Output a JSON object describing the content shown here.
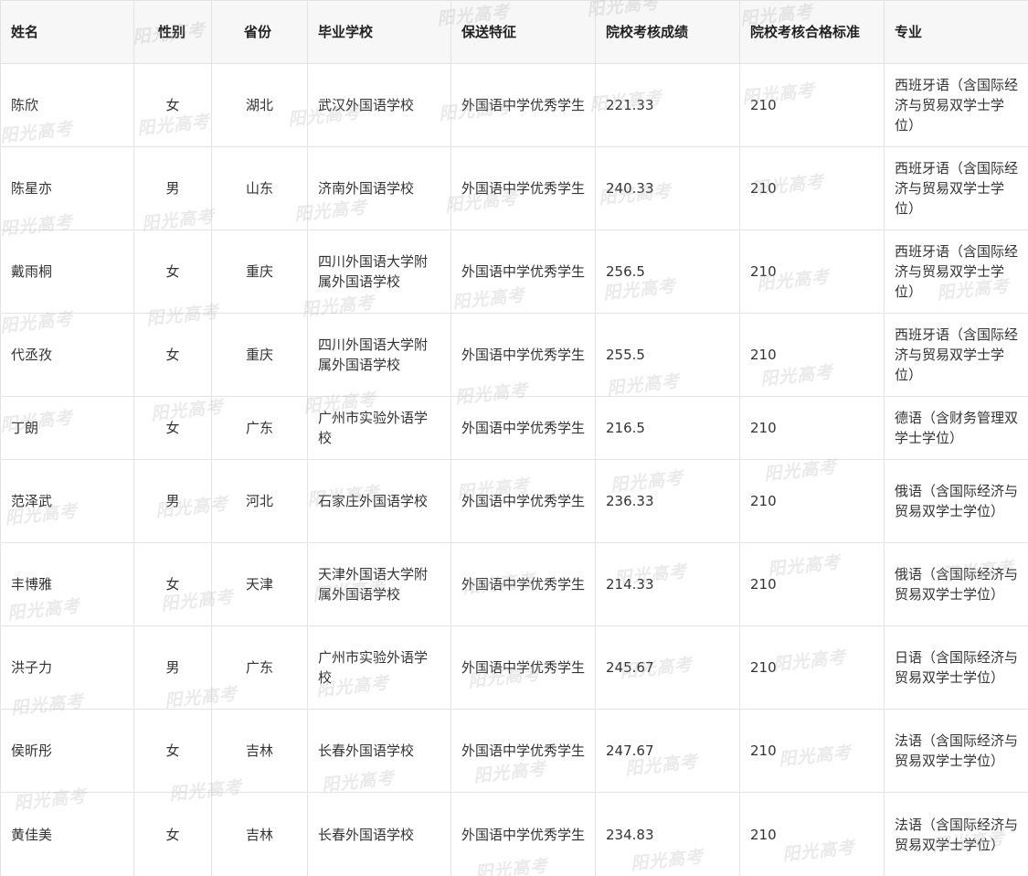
{
  "headers": {
    "name": "姓名",
    "gender": "性别",
    "province": "省份",
    "school": "毕业学校",
    "feature": "保送特征",
    "score": "院校考核成绩",
    "standard": "院校考核合格标准",
    "major": "专业"
  },
  "rows": [
    {
      "name": "陈欣",
      "gender": "女",
      "province": "湖北",
      "school": "武汉外国语学校",
      "feature": "外国语中学优秀学生",
      "score": "221.33",
      "standard": "210",
      "major": "西班牙语（含国际经济与贸易双学士学位）"
    },
    {
      "name": "陈星亦",
      "gender": "男",
      "province": "山东",
      "school": "济南外国语学校",
      "feature": "外国语中学优秀学生",
      "score": "240.33",
      "standard": "210",
      "major": "西班牙语（含国际经济与贸易双学士学位）"
    },
    {
      "name": "戴雨桐",
      "gender": "女",
      "province": "重庆",
      "school": "四川外国语大学附属外国语学校",
      "feature": "外国语中学优秀学生",
      "score": "256.5",
      "standard": "210",
      "major": "西班牙语（含国际经济与贸易双学士学位）"
    },
    {
      "name": "代丞孜",
      "gender": "女",
      "province": "重庆",
      "school": "四川外国语大学附属外国语学校",
      "feature": "外国语中学优秀学生",
      "score": "255.5",
      "standard": "210",
      "major": "西班牙语（含国际经济与贸易双学士学位）"
    },
    {
      "name": "丁朗",
      "gender": "女",
      "province": "广东",
      "school": "广州市实验外语学校",
      "feature": "外国语中学优秀学生",
      "score": "216.5",
      "standard": "210",
      "major": "德语（含财务管理双学士学位）"
    },
    {
      "name": "范泽武",
      "gender": "男",
      "province": "河北",
      "school": "石家庄外国语学校",
      "feature": "外国语中学优秀学生",
      "score": "236.33",
      "standard": "210",
      "major": "俄语（含国际经济与贸易双学士学位）"
    },
    {
      "name": "丰博雅",
      "gender": "女",
      "province": "天津",
      "school": "天津外国语大学附属外国语学校",
      "feature": "外国语中学优秀学生",
      "score": "214.33",
      "standard": "210",
      "major": "俄语（含国际经济与贸易双学士学位）"
    },
    {
      "name": "洪子力",
      "gender": "男",
      "province": "广东",
      "school": "广州市实验外语学校",
      "feature": "外国语中学优秀学生",
      "score": "245.67",
      "standard": "210",
      "major": "日语（含国际经济与贸易双学士学位）"
    },
    {
      "name": "侯昕彤",
      "gender": "女",
      "province": "吉林",
      "school": "长春外国语学校",
      "feature": "外国语中学优秀学生",
      "score": "247.67",
      "standard": "210",
      "major": "法语（含国际经济与贸易双学士学位）"
    },
    {
      "name": "黄佳美",
      "gender": "女",
      "province": "吉林",
      "school": "长春外国语学校",
      "feature": "外国语中学优秀学生",
      "score": "234.83",
      "standard": "210",
      "major": "法语（含国际经济与贸易双学士学位）"
    }
  ],
  "watermark": {
    "text": "阳光高考",
    "color": "#a0a0a0"
  }
}
